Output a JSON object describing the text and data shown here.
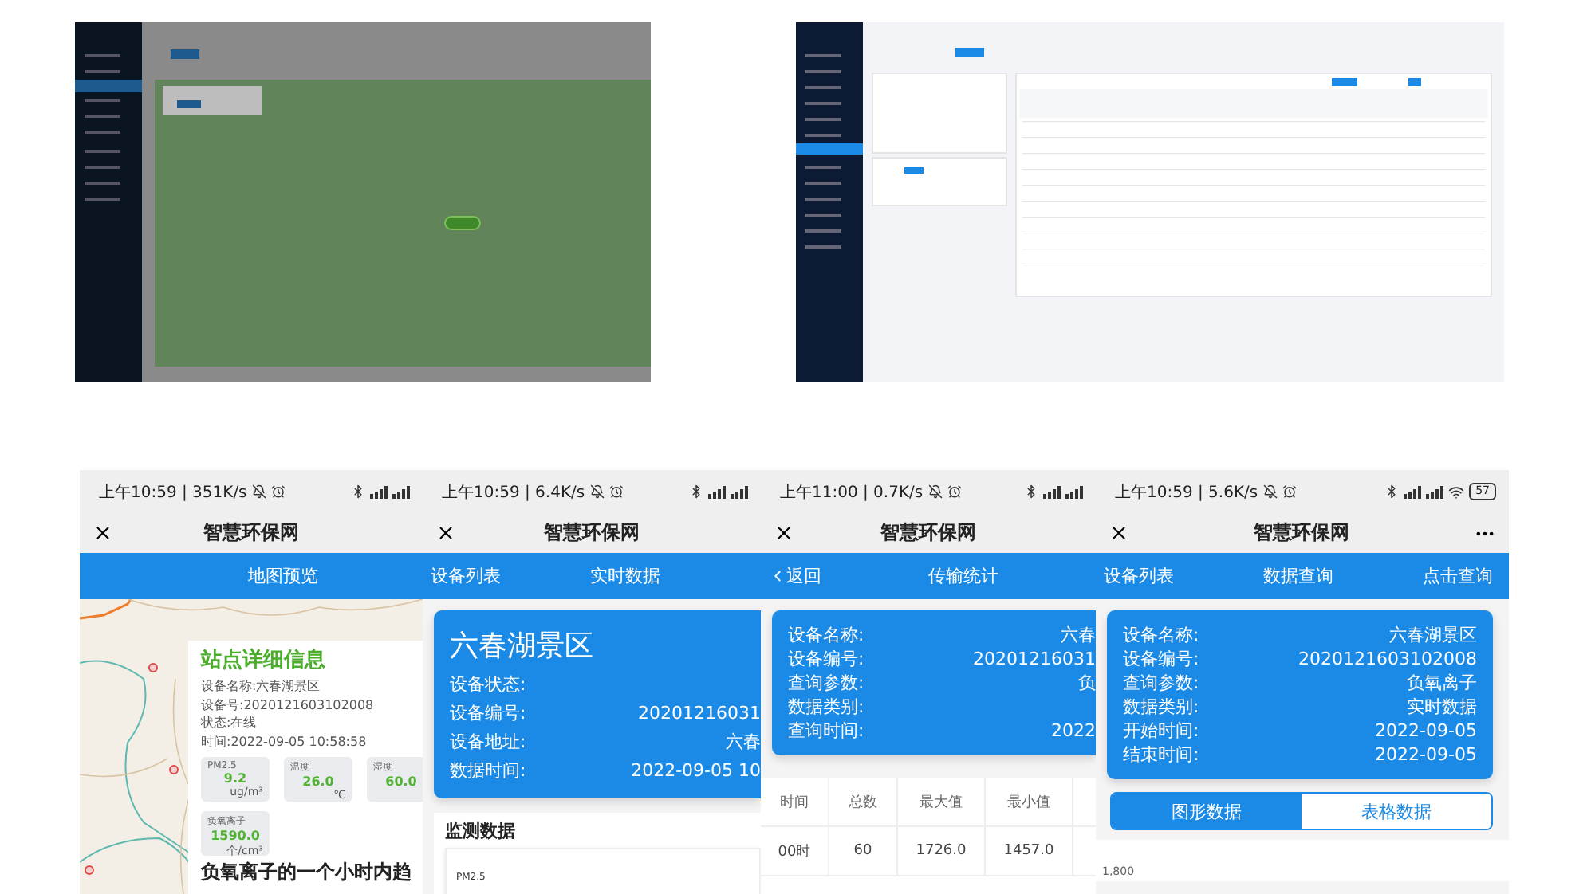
{
  "desktop_screenshots": [
    {
      "kind": "map"
    },
    {
      "kind": "table"
    }
  ],
  "phones": [
    {
      "status": "上午10:59 | 351K/s",
      "title": "智慧环保网",
      "more": false,
      "nav": [
        {
          "label": "地图预览",
          "kind": "plain"
        }
      ],
      "content": {
        "kind": "map",
        "title": "站点详细信息",
        "lines": [
          "设备名称:六春湖景区",
          "设备号:2020121603102008",
          "状态:在线",
          "时间:2022-09-05 10:58:58"
        ],
        "tiles": [
          {
            "label": "PM2.5",
            "value": "9.2",
            "unit": "ug/m³"
          },
          {
            "label": "温度",
            "value": "26.0",
            "unit": "℃"
          },
          {
            "label": "湿度",
            "value": "60.0"
          },
          {
            "label": "负氧离子",
            "value": "1590.0",
            "unit": "个/cm³"
          }
        ],
        "caption": "负氧离子的一个小时内趋"
      }
    },
    {
      "status": "上午10:59 | 6.4K/s",
      "title": "智慧环保网",
      "more": false,
      "nav": [
        {
          "label": "设备列表",
          "kind": "plain"
        },
        {
          "label": "实时数据",
          "kind": "plain"
        }
      ],
      "content": {
        "kind": "realtime",
        "heading": "六春湖景区",
        "rows": [
          {
            "label": "设备状态:",
            "value": ""
          },
          {
            "label": "设备编号:",
            "value": "20201216031"
          },
          {
            "label": "设备地址:",
            "value": "六春"
          },
          {
            "label": "数据时间:",
            "value": "2022-09-05 10"
          }
        ],
        "section": "监测数据",
        "item": "PM2.5"
      }
    },
    {
      "status": "上午11:00 | 0.7K/s",
      "title": "智慧环保网",
      "more": false,
      "nav": [
        {
          "label": "返回",
          "kind": "back"
        },
        {
          "label": "传输统计",
          "kind": "plain"
        }
      ],
      "content": {
        "kind": "stats",
        "rows": [
          {
            "label": "设备名称:",
            "value": "六春"
          },
          {
            "label": "设备编号:",
            "value": "20201216031"
          },
          {
            "label": "查询参数:",
            "value": "负"
          },
          {
            "label": "数据类别:",
            "value": ""
          },
          {
            "label": "查询时间:",
            "value": "2022"
          }
        ],
        "columns": [
          "时间",
          "总数",
          "最大值",
          "最小值"
        ],
        "table": [
          [
            "00时",
            "60",
            "1726.0",
            "1457.0"
          ]
        ]
      }
    },
    {
      "status": "上午10:59 | 5.6K/s",
      "battery": "57",
      "title": "智慧环保网",
      "more": true,
      "nav": [
        {
          "label": "设备列表",
          "kind": "plain"
        },
        {
          "label": "数据查询",
          "kind": "plain"
        },
        {
          "label": "点击查询",
          "kind": "plain"
        }
      ],
      "content": {
        "kind": "query",
        "rows": [
          {
            "label": "设备名称:",
            "value": "六春湖景区"
          },
          {
            "label": "设备编号:",
            "value": "2020121603102008"
          },
          {
            "label": "查询参数:",
            "value": "负氧离子"
          },
          {
            "label": "数据类别:",
            "value": "实时数据"
          },
          {
            "label": "开始时间:",
            "value": "2022-09-05"
          },
          {
            "label": "结束时间:",
            "value": "2022-09-05"
          }
        ],
        "toggle": [
          {
            "label": "图形数据",
            "selected": true
          },
          {
            "label": "表格数据",
            "selected": false
          }
        ],
        "tick": "1,800"
      }
    }
  ]
}
